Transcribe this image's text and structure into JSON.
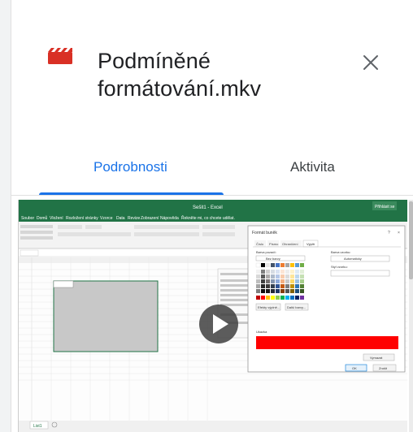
{
  "file": {
    "title_line1": "Podmíněné",
    "title_line2": "formátování.mkv",
    "icon": "video-file-icon",
    "icon_color": "#d93025"
  },
  "tabs": {
    "details": "Podrobnosti",
    "activity": "Aktivita"
  },
  "colors": {
    "accent": "#1a73e8",
    "excel_green": "#217346"
  },
  "video_preview": {
    "window_title": "Sešit1 - Excel",
    "signin": "Přihlásit se",
    "ribbon_tabs": [
      "Soubor",
      "Domů",
      "Vložení",
      "Rozložení stránky",
      "Vzorce",
      "Data",
      "Revize",
      "Zobrazení",
      "Nápověda"
    ],
    "search_hint": "Řekněte mi, co chcete udělat.",
    "dialog_title": "Formát buněk",
    "dialog_tabs": [
      "Číslo",
      "Písmo",
      "Ohraničení",
      "Výplň"
    ],
    "background_color_label": "Barva pozadí:",
    "no_color": "Bez barvy",
    "fill_effects": "Efekty výplně...",
    "more_colors": "Další barvy...",
    "pattern_color_label": "Barva vzorku:",
    "pattern_color_value": "Automaticky",
    "pattern_style_label": "Styl vzorku:",
    "sample_label": "Ukázka",
    "clear_button": "Vymazat",
    "ok_button": "OK",
    "cancel_button": "Zrušit",
    "sheet_tab": "List1",
    "play_icon": "play-icon"
  }
}
